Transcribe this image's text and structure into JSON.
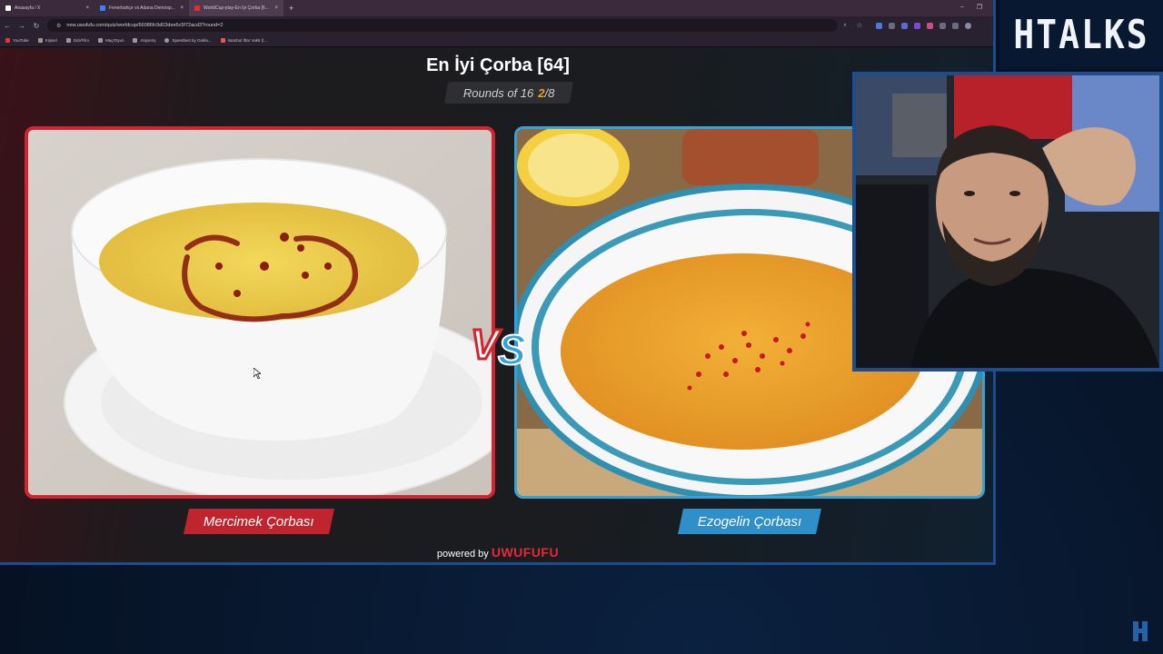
{
  "browser": {
    "tabs": [
      {
        "label": "Anasayfa / X",
        "favicon_color": "#ffffff"
      },
      {
        "label": "Fenerbahçe vs Adana Demirsp...",
        "favicon_color": "#3b82f6"
      },
      {
        "label": "WorldCup-play-En İyi Çorba [6...",
        "favicon_color": "#e8283a",
        "active": true
      }
    ],
    "new_tab": "+",
    "window_controls": [
      "–",
      "❐"
    ],
    "url": "new.uwufufu.com/quiz/worldcup/66086fc9d03dee6c5f72acd3?round=2",
    "bookmarks": [
      "YouTube",
      "Kişisel",
      "Dizi/Film",
      "Maç/Oyun",
      "Alışveriş",
      "Speedtest by Ookla...",
      "İstanbul İftar Vakti (İ..."
    ]
  },
  "quiz": {
    "title": "En İyi Çorba [64]",
    "round_label": "Rounds of 16",
    "round_current": "2",
    "round_total": "/8",
    "vs_text": "VS",
    "left_choice": "Mercimek Çorbası",
    "right_choice": "Ezogelin Çorbası",
    "powered_by": "powered by",
    "brand": "UWUFUFU"
  },
  "overlay": {
    "channel_logo": "HTALKS"
  },
  "colors": {
    "left_accent": "#d3232e",
    "right_accent": "#34a3d8",
    "round_highlight": "#f0a020",
    "frame_blue": "#1e4d8f"
  }
}
